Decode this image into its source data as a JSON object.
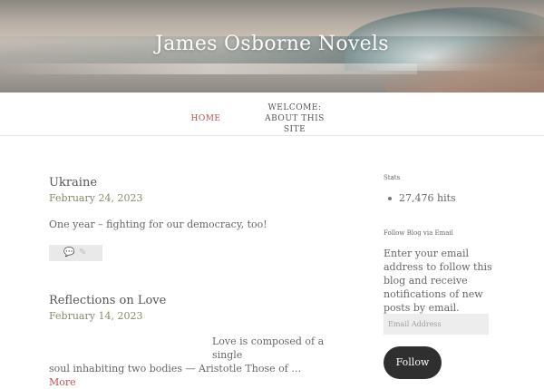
{
  "site": {
    "title": "James Osborne Novels"
  },
  "nav": {
    "items": [
      {
        "label": "HOME"
      },
      {
        "label": "WELCOME: ABOUT THIS SITE"
      }
    ]
  },
  "posts": [
    {
      "title": "Ukraine",
      "date": "February 24, 2023",
      "excerpt": "One year – fighting for our democracy, too!"
    },
    {
      "title": "Reflections on Love",
      "date": "February 14, 2023",
      "excerpt_line1": "Love is composed of a single",
      "excerpt_line2": "soul inhabiting two bodies — Aristotle Those of …",
      "more_label": "More"
    }
  ],
  "post_meta": {
    "comment_icon": "comment-icon",
    "permalink_icon": "link-icon",
    "comment_glyph": "💬",
    "link_glyph": "✎"
  },
  "sidebar": {
    "stats": {
      "title": "Stats",
      "hits": "27,476 hits"
    },
    "follow": {
      "title": "Follow Blog via Email",
      "description": "Enter your email address to follow this blog and receive notifications of new posts by email.",
      "email_placeholder": "Email Address",
      "button_label": "Follow"
    }
  },
  "colors": {
    "accent": "#c0504d",
    "button_bg": "#2f2f2f"
  }
}
